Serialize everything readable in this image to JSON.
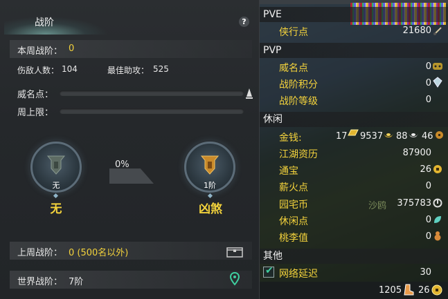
{
  "left": {
    "title": "战阶",
    "help": "?",
    "weekly_label": "本周战阶：",
    "weekly_value": "0",
    "kills_label": "伤敌人数：",
    "kills_value": "104",
    "assist_label": "最佳助攻：",
    "assist_value": "525",
    "prestige_label": "威名点：",
    "weekly_cap_label": "周上限：",
    "prestige_progress": 0,
    "weekly_cap_progress": 0,
    "current_rank_sub": "无",
    "current_rank_name": "无",
    "progress_percent": "0%",
    "next_rank_sub": "1阶",
    "next_rank_name": "凶煞",
    "last_week_label": "上周战阶：",
    "last_week_value": "0 (500名以外)",
    "world_label": "世界战阶：",
    "world_value": "7阶"
  },
  "right": {
    "pve_header": "PVE",
    "pvp_header": "PVP",
    "leisure_header": "休闲",
    "other_header": "其他",
    "xiaxing_label": "侠行点",
    "xiaxing_value": "21680",
    "weiming_label": "威名点",
    "weiming_value": "0",
    "zhanjie_points_label": "战阶积分",
    "zhanjie_points_value": "0",
    "zhanjie_level_label": "战阶等级",
    "zhanjie_level_value": "0",
    "money_label": "金钱:",
    "money_gold_bar": "17",
    "money_gold": "9537",
    "money_silver": "88",
    "money_copper": "46",
    "jianghu_label": "江湖资历",
    "jianghu_value": "87900",
    "tongbao_label": "通宝",
    "tongbao_value": "26",
    "xinhuo_label": "薪火点",
    "xinhuo_value": "0",
    "yuanzhai_label": "园宅币",
    "yuanzhai_value": "375783",
    "xiuxian_label": "休闲点",
    "xiuxian_value": "0",
    "taoli_label": "桃李值",
    "taoli_value": "0",
    "latency_label": "网络延迟",
    "latency_value": "30",
    "latency_checked": true,
    "bottom_left_value": "1205",
    "bottom_right_value": "26",
    "watermark": "沙鸥"
  },
  "colors": {
    "accent_yellow": "#f4d33c",
    "panel_bg": "#2b2e31"
  },
  "icons": [
    "help-icon",
    "helmet-icon",
    "chest-icon",
    "location-pin-icon",
    "brush-icon",
    "mask-icon",
    "crystal-icon",
    "gold-bar-icon",
    "gold-ingot-icon",
    "silver-ingot-icon",
    "copper-coin-icon",
    "coin-icon",
    "house-coin-icon",
    "leaf-icon",
    "gourd-icon",
    "checkbox-check-icon",
    "boot-icon"
  ]
}
